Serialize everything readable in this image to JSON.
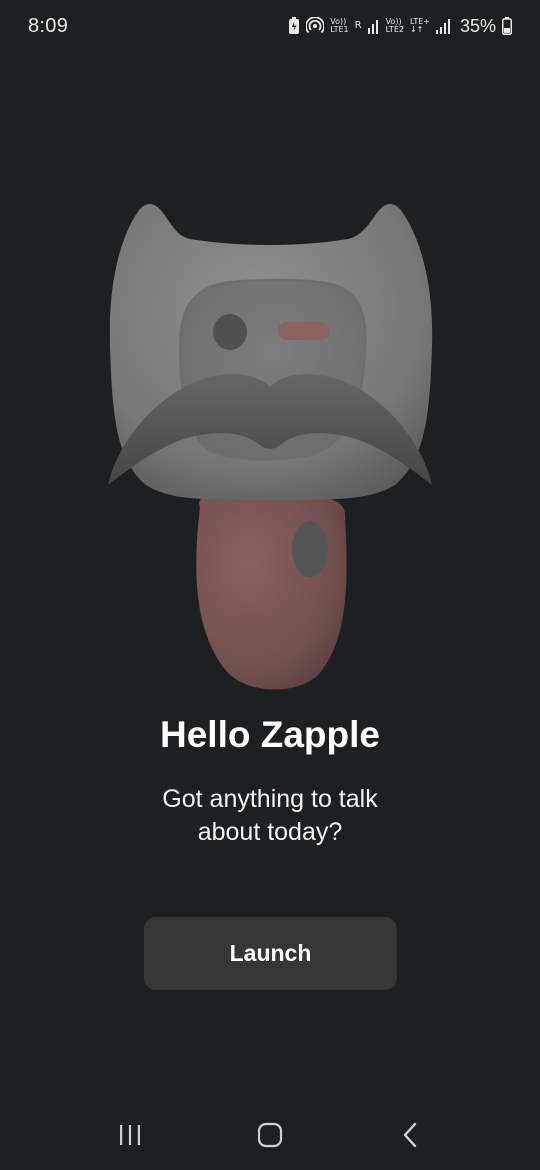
{
  "status_bar": {
    "time": "8:09",
    "sim1_label_top": "Vo))",
    "sim1_label_bottom": "LTE1",
    "sim1_roaming": "R",
    "sim2_label_top": "Vo))",
    "sim2_label_bottom": "LTE2",
    "sim2_network": "LTE+",
    "battery_percent": "35%"
  },
  "main": {
    "greeting": "Hello Zapple",
    "subtitle_line1": "Got anything to talk",
    "subtitle_line2": "about today?",
    "launch_label": "Launch"
  },
  "icons": {
    "status": [
      "battery-saver-icon",
      "hotspot-icon",
      "signal-icon",
      "battery-icon"
    ],
    "nav": [
      "recent-apps-icon",
      "home-icon",
      "back-icon"
    ]
  },
  "colors": {
    "background": "#1d1f21",
    "button": "#363636",
    "mascot_head": "#7a7a7a",
    "mascot_body": "#7a5454",
    "mustache": "#555555"
  }
}
